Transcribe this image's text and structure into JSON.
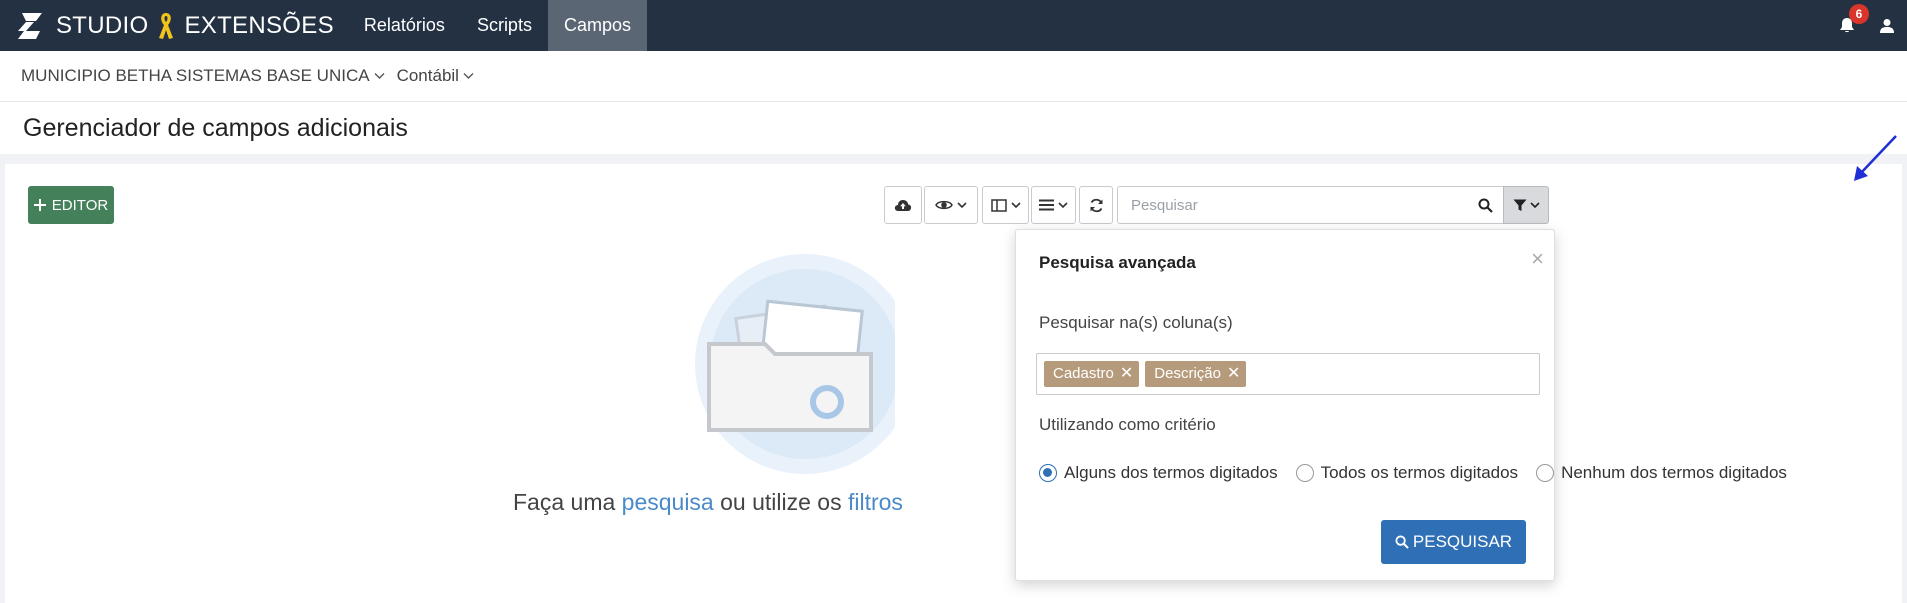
{
  "topbar": {
    "brand_studio": "STUDIO",
    "brand_extensions": "EXTENSÕES",
    "nav": [
      {
        "label": "Relatórios"
      },
      {
        "label": "Scripts"
      },
      {
        "label": "Campos",
        "active": true
      }
    ],
    "notifications_count": "6"
  },
  "context": {
    "entity": "MUNICIPIO BETHA SISTEMAS BASE UNICA",
    "system": "Contábil"
  },
  "page": {
    "title": "Gerenciador de campos adicionais"
  },
  "toolbar": {
    "editor_label": "EDITOR",
    "search_placeholder": "Pesquisar",
    "search_value": ""
  },
  "empty_state": {
    "text_before": "Faça uma ",
    "link1": "pesquisa",
    "text_middle": " ou utilize os ",
    "link2": "filtros"
  },
  "advanced_search": {
    "title": "Pesquisa avançada",
    "close": "×",
    "columns_label": "Pesquisar na(s) coluna(s)",
    "columns": [
      {
        "label": "Cadastro"
      },
      {
        "label": "Descrição"
      }
    ],
    "criteria_label": "Utilizando como critério",
    "criteria": [
      {
        "label": "Alguns dos termos digitados",
        "checked": true
      },
      {
        "label": "Todos os termos digitados",
        "checked": false
      },
      {
        "label": "Nenhum dos termos digitados",
        "checked": false
      }
    ],
    "submit_label": "PESQUISAR"
  },
  "colors": {
    "navbar": "#233142",
    "active_nav": "#5b6674",
    "editor_button": "#44805a",
    "primary": "#2f6fb5",
    "tag": "#b59b7c",
    "badge": "#d9352b",
    "link": "#4a8ac9",
    "annotation_arrow": "#1f2fd6"
  }
}
